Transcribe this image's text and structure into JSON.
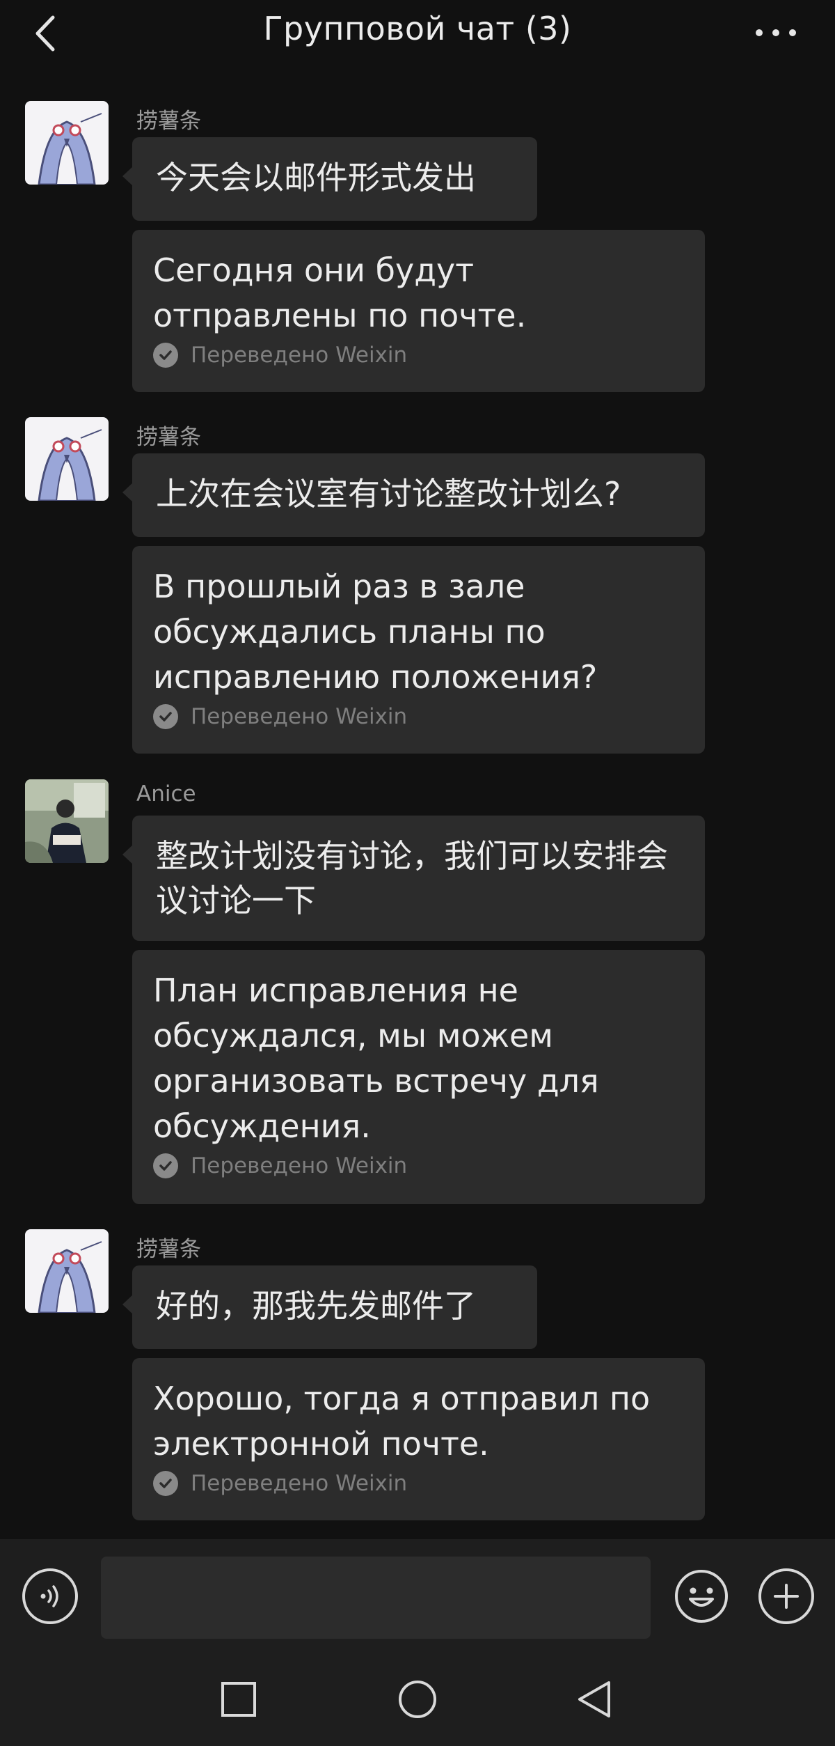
{
  "header": {
    "title": "Групповой чат (3)",
    "back_icon": "chevron-left-icon",
    "more_icon": "more-horizontal-icon"
  },
  "messages": [
    {
      "sender": "捞薯条",
      "avatar": "bird-sticker-avatar",
      "original": "今天会以邮件形式发出",
      "translation": "Сегодня они будут отправлены по почте.",
      "translated_note": "Переведено Weixin"
    },
    {
      "sender": "捞薯条",
      "avatar": "bird-sticker-avatar",
      "original": "上次在会议室有讨论整改计划么?",
      "translation": "В прошлый раз в зале обсуждались планы по исправлению положения?",
      "translated_note": "Переведено Weixin"
    },
    {
      "sender": "Anice",
      "avatar": "photo-avatar",
      "original": "整改计划没有讨论，我们可以安排会议讨论一下",
      "translation": "План исправления не обсуждался, мы можем организовать встречу для обсуждения.",
      "translated_note": "Переведено Weixin"
    },
    {
      "sender": "捞薯条",
      "avatar": "bird-sticker-avatar",
      "original": "好的，那我先发邮件了",
      "translation": "Хорошо, тогда я отправил по электронной почте.",
      "translated_note": "Переведено Weixin"
    }
  ],
  "input_bar": {
    "voice_icon": "voice-icon",
    "input_value": "",
    "emoji_icon": "emoji-icon",
    "add_icon": "plus-icon"
  },
  "nav_bar": {
    "icons": [
      "recents-square-icon",
      "home-circle-icon",
      "back-triangle-icon"
    ]
  },
  "colors": {
    "background": "#111111",
    "bubble": "#2c2c2c",
    "text": "#ececec",
    "muted": "#9a9a9a"
  }
}
